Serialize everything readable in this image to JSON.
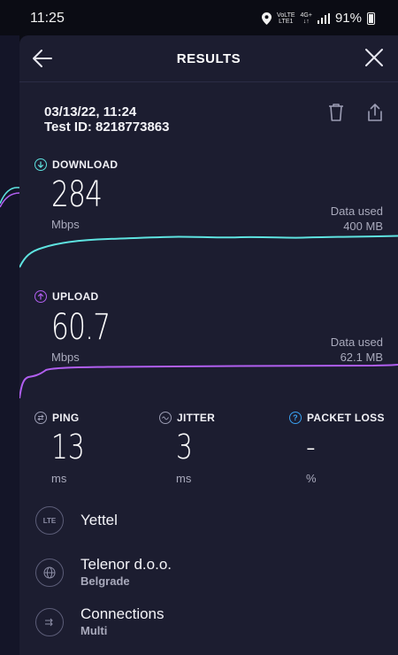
{
  "status_bar": {
    "time": "11:25",
    "network_top": "VoLTE",
    "network_bottom": "LTE1",
    "network_type": "4G+",
    "battery": "91%",
    "icons": [
      "location-icon",
      "signal-icon",
      "battery-icon"
    ]
  },
  "header": {
    "title": "RESULTS"
  },
  "test": {
    "datetime": "03/13/22, 11:24",
    "test_id": "Test ID: 8218773863"
  },
  "download": {
    "label": "DOWNLOAD",
    "value": "284",
    "unit": "Mbps",
    "data_used_label": "Data used",
    "data_used_value": "400 MB",
    "color": "#5ee3e0"
  },
  "upload": {
    "label": "UPLOAD",
    "value": "60.7",
    "unit": "Mbps",
    "data_used_label": "Data used",
    "data_used_value": "62.1 MB",
    "color": "#b15ff0"
  },
  "ping": {
    "label": "PING",
    "value": "13",
    "unit": "ms"
  },
  "jitter": {
    "label": "JITTER",
    "value": "3",
    "unit": "ms"
  },
  "packet_loss": {
    "label": "PACKET LOSS",
    "value": "-",
    "unit": "%"
  },
  "provider": {
    "badge": "LTE",
    "name": "Yettel"
  },
  "server": {
    "name": "Telenor d.o.o.",
    "location": "Belgrade"
  },
  "connections": {
    "label": "Connections",
    "value": "Multi"
  },
  "colors": {
    "sheet_bg": "#1c1d30",
    "accent_download": "#5ee3e0",
    "accent_upload": "#b15ff0",
    "accent_info": "#3aa0f0"
  }
}
